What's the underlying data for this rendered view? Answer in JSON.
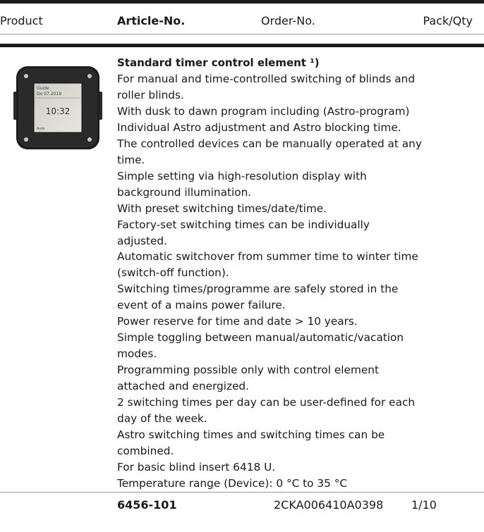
{
  "header": {
    "product": "Product",
    "article_no": "Article-No.",
    "order_no": "Order-No.",
    "pack_qty": "Pack/Qty"
  },
  "item": {
    "title": "Standard timer control element ¹)",
    "image_icon": "timer-control-device-image",
    "display": {
      "line1": "Guide",
      "line2": "Do 07.2019",
      "time": "10:32",
      "status": "Auto"
    },
    "description_lines": [
      "For manual and time-controlled switching of blinds and",
      "roller blinds.",
      "With dusk to dawn program including (Astro-program)",
      "Individual Astro adjustment and Astro blocking time.",
      "The controlled devices can be manually operated at any",
      "time.",
      "Simple setting via high-resolution display with",
      "background illumination.",
      "With preset switching times/date/time.",
      "Factory-set switching times can be individually",
      "adjusted.",
      "Automatic switchover from summer time to winter time",
      "(switch-off function).",
      "Switching times/programme are safely stored in the",
      "event of a mains power failure.",
      "Power reserve for time and date > 10 years.",
      "Simple toggling between manual/automatic/vacation",
      "modes.",
      "Programming possible only with control element",
      "attached and energized.",
      "2 switching times per day can be user-defined for each",
      "day of the week.",
      "Astro switching times and switching times can be",
      "combined.",
      "For basic blind insert 6418 U.",
      "Temperature range (Device): 0 °C to 35 °C"
    ],
    "article_no": "6456-101",
    "order_no": "2CKA006410A0398",
    "pack_qty": "1/10"
  }
}
